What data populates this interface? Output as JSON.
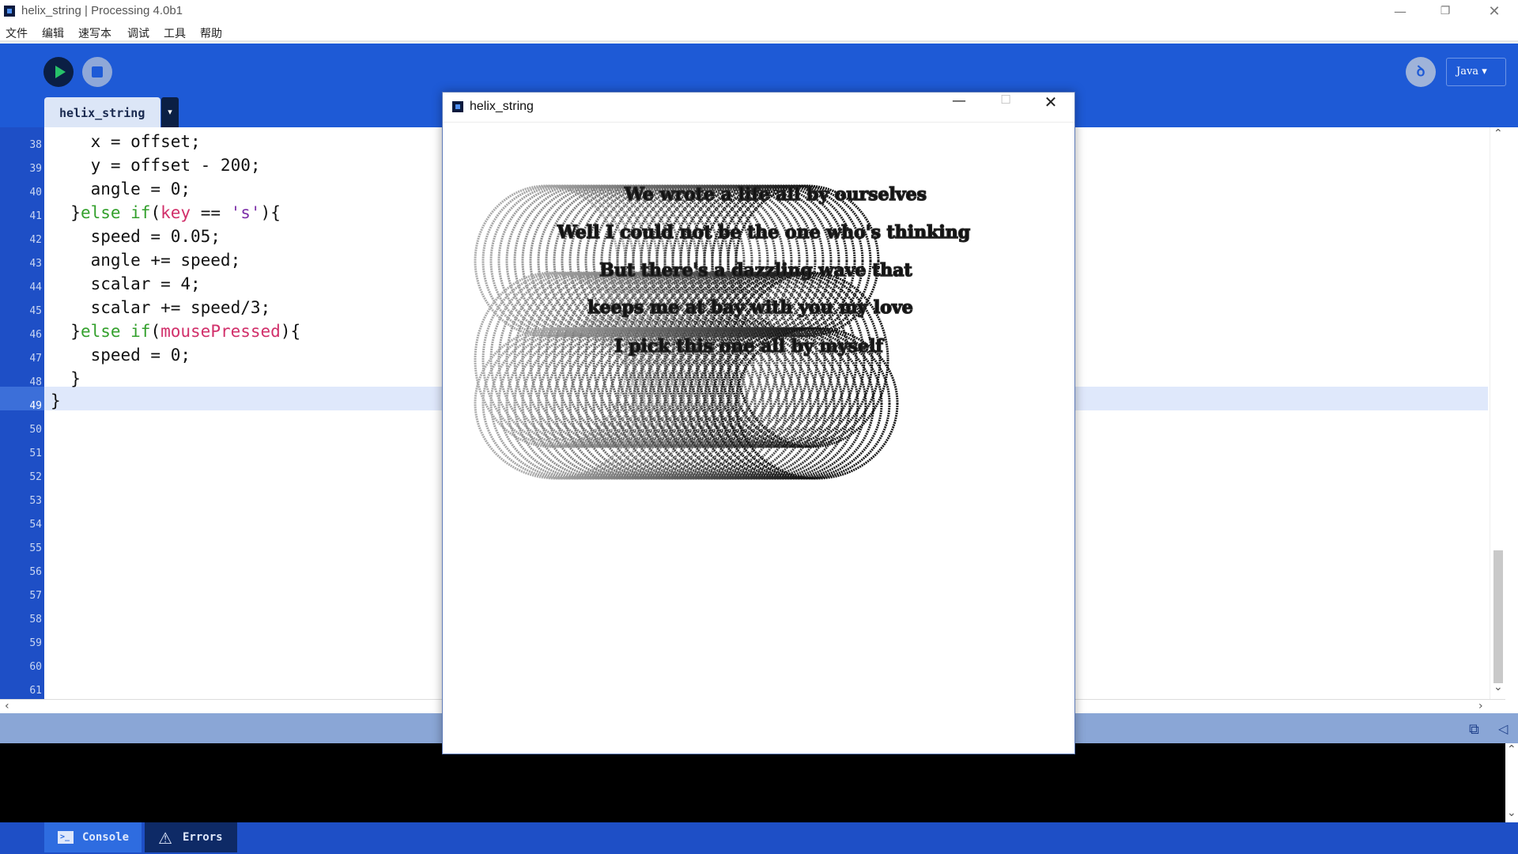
{
  "app": {
    "title": "helix_string | Processing 4.0b1",
    "minimize": "—",
    "maximize": "❐",
    "close": "✕"
  },
  "menu": [
    "文件",
    "编辑",
    "速写本",
    "调试",
    "工具",
    "帮助"
  ],
  "toolbar": {
    "run_icon": "play-icon",
    "stop_icon": "stop-icon",
    "debug_glyph": "ꝺ",
    "mode": "Java ▾"
  },
  "tabs": {
    "sketch_tab": "helix_string",
    "tab_menu": "▾"
  },
  "editor": {
    "line_numbers": [
      "38",
      "39",
      "40",
      "41",
      "42",
      "43",
      "44",
      "45",
      "46",
      "47",
      "48",
      "49",
      "50",
      "51",
      "52",
      "53",
      "54",
      "55",
      "56",
      "57",
      "58",
      "59",
      "60",
      "61"
    ],
    "highlighted_line": "49",
    "code": [
      "    x = offset;",
      "    y = offset - 200;",
      "    angle = 0;",
      "  }else if(key == 's'){",
      "    speed = 0.05;",
      "    angle += speed;",
      "    scalar = 4;",
      "    scalar += speed/3;",
      "  }else if(mousePressed){",
      "    speed = 0;",
      "  }",
      "}"
    ]
  },
  "bottom_tabs": {
    "console": "Console",
    "errors": "Errors",
    "console_icon_glyph": ">_",
    "errors_icon_glyph": "⚠"
  },
  "statusbar": {
    "copy_glyph": "⧉",
    "collapse_glyph": "◁"
  },
  "sketch": {
    "title": "helix_string",
    "minimize": "—",
    "maximize": "☐",
    "close": "✕",
    "lines": [
      "We wrote a life all by ourselves",
      "Well I could not be the one who's thinking",
      "But there's a dazzling wave that",
      "keeps me at bay with you my love",
      "I pick this one all by myself"
    ]
  }
}
